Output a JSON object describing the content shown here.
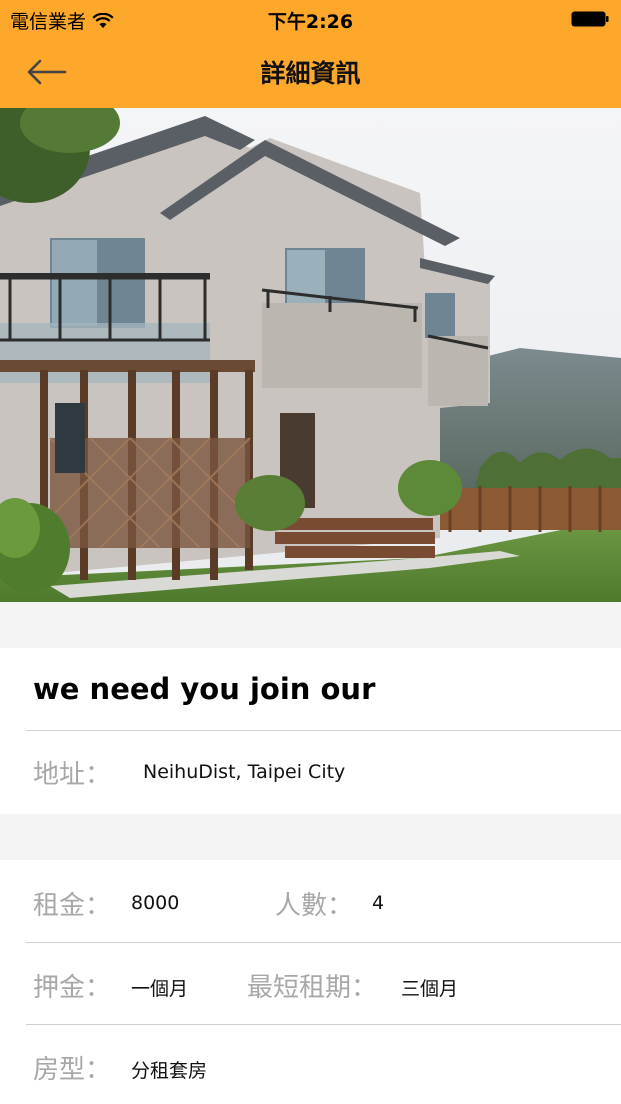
{
  "status_bar": {
    "carrier": "電信業者",
    "time": "下午2:26"
  },
  "nav": {
    "title": "詳細資訊",
    "back_icon": "back-arrow-icon"
  },
  "photo": {
    "subject": "house-photo"
  },
  "listing": {
    "title": "we need you join our",
    "address_label": "地址：",
    "address_value": "NeihuDist, Taipei City"
  },
  "details": {
    "rent_label": "租金：",
    "rent_value": "8000",
    "people_label": "人數：",
    "people_value": "4",
    "deposit_label": "押金：",
    "deposit_value": "一個月",
    "min_term_label": "最短租期：",
    "min_term_value": "三個月",
    "room_type_label": "房型：",
    "room_type_value": "分租套房"
  },
  "colors": {
    "accent": "#fda72b",
    "label_gray": "#a8a8a8",
    "section_bg": "#f4f4f4"
  }
}
